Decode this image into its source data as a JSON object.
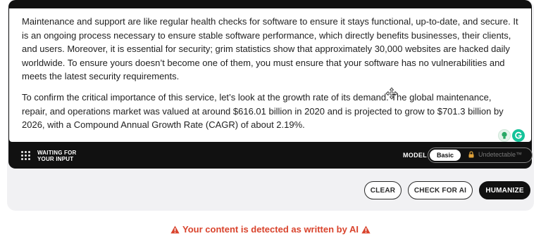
{
  "editor": {
    "paragraph_1": "Maintenance and support are like regular health checks for software to ensure it stays functional, up-to-date, and secure. It is an ongoing process necessary to ensure stable software performance, which directly benefits businesses, their clients, and users. Moreover, it is essential for security; grim statistics show that approximately 30,000 websites are hacked daily worldwide. To ensure yours doesn’t become one of them, you must ensure that your software has no vulnerabilities and meets the latest security requirements.",
    "paragraph_2": "To confirm the critical importance of this service, let’s look at the growth rate of its demand. The global maintenance, repair, and operations market was valued at around $616.01 billion in 2020 and is projected to grow to $701.3 billion by 2026, with a Compound Annual Growth Rate (CAGR) of about 2.19%."
  },
  "status_bar": {
    "status_line_1": "WAITING FOR",
    "status_line_2": "YOUR INPUT",
    "model_label": "MODEL",
    "model_basic": "Basic",
    "model_undetectable": "Undetectable™"
  },
  "actions": {
    "clear_label": "CLEAR",
    "check_label": "CHECK FOR AI",
    "humanize_label": "HUMANIZE"
  },
  "alert": {
    "message": "Your content is detected as written by AI"
  },
  "colors": {
    "frame": "#111111",
    "alert": "#d9432c",
    "grammarly": "#15c39a"
  },
  "icons": [
    "dots-grid-icon",
    "move-cursor-icon",
    "lightbulb-icon",
    "grammarly-icon",
    "lock-icon",
    "warning-icon"
  ]
}
